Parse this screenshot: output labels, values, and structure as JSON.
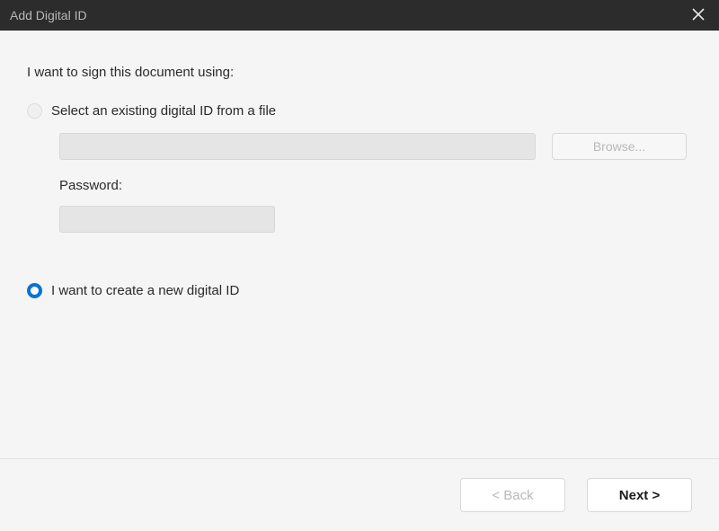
{
  "titlebar": {
    "title": "Add Digital ID"
  },
  "main": {
    "intro": "I want to sign this document using:",
    "option1": {
      "label": "Select an existing digital ID from a file",
      "file_value": "",
      "file_placeholder": "",
      "browse_label": "Browse...",
      "password_label": "Password:",
      "password_value": ""
    },
    "option2": {
      "label": "I want to create a new digital ID"
    }
  },
  "footer": {
    "back_label": "< Back",
    "next_label": "Next >"
  }
}
